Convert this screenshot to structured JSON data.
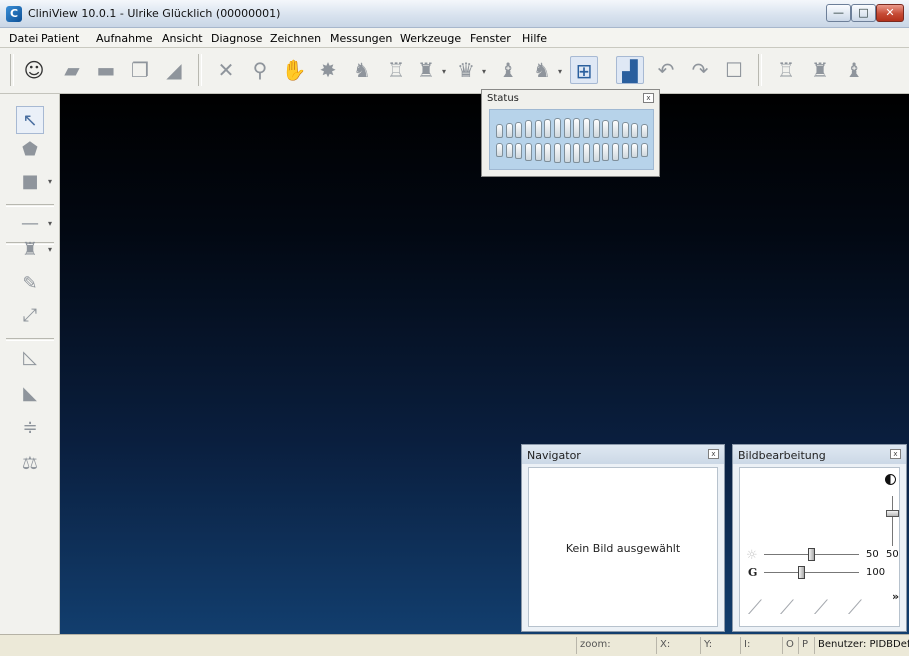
{
  "window": {
    "title": "CliniView 10.0.1 - Ulrike Glücklich (00000001)",
    "app_icon_glyph": "C",
    "buttons": {
      "minimize": "—",
      "maximize": "□",
      "close": "✕"
    }
  },
  "menu": {
    "items": [
      "Datei",
      "Patient",
      "Aufnahme",
      "Ansicht",
      "Diagnose",
      "Zeichnen",
      "Messungen",
      "Werkzeuge",
      "Fenster",
      "Hilfe"
    ]
  },
  "toolbar": {
    "icons": [
      {
        "name": "patient-head-icon",
        "glyph": "☺"
      },
      {
        "name": "folder-open-icon",
        "glyph": "▰"
      },
      {
        "name": "save-icon",
        "glyph": "▬"
      },
      {
        "name": "copy-icon",
        "glyph": "❐"
      },
      {
        "name": "eraser-icon",
        "glyph": "◢"
      },
      {
        "name": "fit-arrows-icon",
        "glyph": "✕"
      },
      {
        "name": "zoom-icon",
        "glyph": "⚲"
      },
      {
        "name": "pan-hand-icon",
        "glyph": "✋"
      },
      {
        "name": "brightness-icon",
        "glyph": "✸"
      },
      {
        "name": "tooth-scan-icon",
        "glyph": "♞"
      },
      {
        "name": "tooth-pair-icon",
        "glyph": "♖"
      },
      {
        "name": "tooth-set-icon",
        "glyph": "♜"
      },
      {
        "name": "tooth-arrange-icon",
        "glyph": "♛"
      },
      {
        "name": "tooth-single-icon",
        "glyph": "♝"
      },
      {
        "name": "tooth-multi-icon",
        "glyph": "♞"
      },
      {
        "name": "layout-grid-icon",
        "glyph": "⊞"
      },
      {
        "name": "histogram-icon",
        "glyph": "▟"
      },
      {
        "name": "undo-icon",
        "glyph": "↶"
      },
      {
        "name": "redo-icon",
        "glyph": "↷"
      },
      {
        "name": "frame-icon",
        "glyph": "☐"
      },
      {
        "name": "tooth-view-a-icon",
        "glyph": "♖"
      },
      {
        "name": "tooth-view-b-icon",
        "glyph": "♜"
      },
      {
        "name": "tooth-view-c-icon",
        "glyph": "♝"
      }
    ],
    "dropdown_glyph": "▾"
  },
  "left_toolbar": {
    "icons": [
      {
        "name": "select-arrow-icon",
        "glyph": "↖"
      },
      {
        "name": "shape-icon",
        "glyph": "⬟"
      },
      {
        "name": "fill-color-icon",
        "glyph": "■"
      },
      {
        "name": "line-style-icon",
        "glyph": "—"
      },
      {
        "name": "tooth-tool-icon",
        "glyph": "♜"
      },
      {
        "name": "annotate-icon",
        "glyph": "✎"
      },
      {
        "name": "transform-icon",
        "glyph": "⤢"
      },
      {
        "name": "angle-measure-icon",
        "glyph": "◺"
      },
      {
        "name": "triangle-measure-icon",
        "glyph": "◣"
      },
      {
        "name": "distance-measure-icon",
        "glyph": "≑"
      },
      {
        "name": "compare-icon",
        "glyph": "⚖"
      }
    ],
    "dropdown_glyph": "▾"
  },
  "status_panel": {
    "title": "Status",
    "close_glyph": "x"
  },
  "navigator": {
    "title": "Navigator",
    "close_glyph": "x",
    "empty_text": "Kein Bild ausgewählt"
  },
  "bildbearbeitung": {
    "title": "Bildbearbeitung",
    "close_glyph": "x",
    "contrast_icon": "contrast-icon",
    "brightness_glyph": "☼",
    "gamma_label": "G",
    "brightness_value": "50",
    "contrast_value": "50",
    "gamma_value": "100",
    "curve_glyph": "⟋",
    "more_glyph": "»"
  },
  "statusbar": {
    "zoom_label": "zoom:",
    "x_label": "X:",
    "y_label": "Y:",
    "i_label": "I:",
    "o_label": "O",
    "p_label": "P",
    "user_text": "Benutzer: PIDBDefau"
  }
}
